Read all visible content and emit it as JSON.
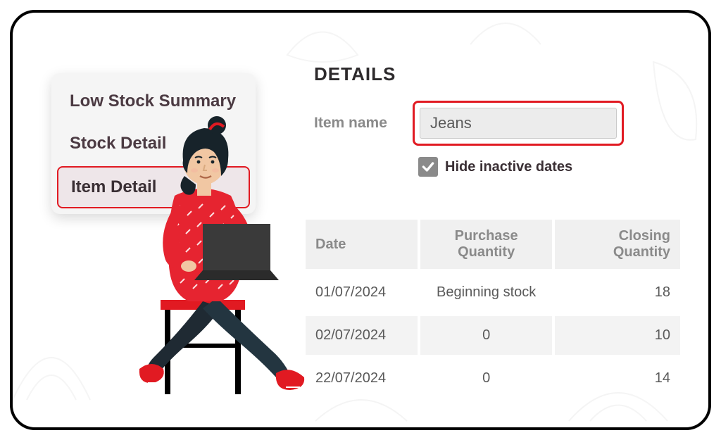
{
  "sidebar": {
    "items": [
      {
        "label": "Low Stock Summary",
        "active": false
      },
      {
        "label": "Stock Detail",
        "active": false
      },
      {
        "label": "Item Detail",
        "active": true
      }
    ]
  },
  "details": {
    "heading": "DETAILS",
    "item_name_label": "Item name",
    "item_name_value": "Jeans",
    "hide_inactive_label": "Hide inactive dates",
    "hide_inactive_checked": true
  },
  "table": {
    "columns": [
      "Date",
      "Purchase Quantity",
      "Closing Quantity"
    ],
    "rows": [
      {
        "date": "01/07/2024",
        "purchase": "Beginning stock",
        "closing": "18"
      },
      {
        "date": "02/07/2024",
        "purchase": "0",
        "closing": "10"
      },
      {
        "date": "22/07/2024",
        "purchase": "0",
        "closing": "14"
      }
    ]
  },
  "colors": {
    "accent": "#e11a22"
  }
}
